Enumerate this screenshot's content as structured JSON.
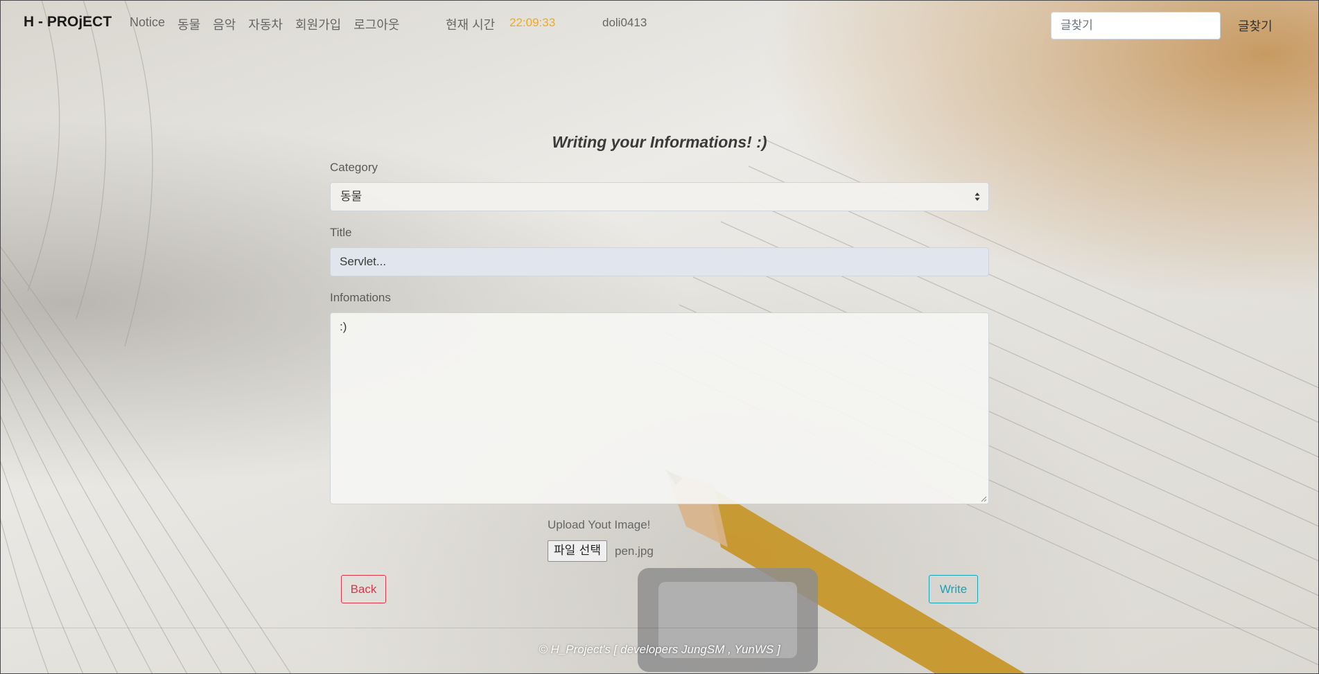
{
  "nav": {
    "brand": "H - PROjECT",
    "links": [
      "Notice",
      "동물",
      "음악",
      "자동차",
      "회원가입",
      "로그아웃"
    ],
    "time_label": "현재 시간",
    "time_value": "22:09:33",
    "username": "doli0413",
    "search_placeholder": "글찾기",
    "search_button": "글찾기"
  },
  "form": {
    "heading": "Writing your Informations! :)",
    "category_label": "Category",
    "category_value": "동물",
    "title_label": "Title",
    "title_value": "Servlet...",
    "info_label": "Infomations",
    "info_value": ":)",
    "upload_label": "Upload Yout Image!",
    "file_button": "파일 선택",
    "file_name": "pen.jpg",
    "back_button": "Back",
    "write_button": "Write"
  },
  "footer": {
    "text": "© H_Project's [ developers JungSM , YunWS ]"
  },
  "colors": {
    "time": "#f2a91c",
    "back": "#dc3545",
    "write": "#17a2b8"
  }
}
